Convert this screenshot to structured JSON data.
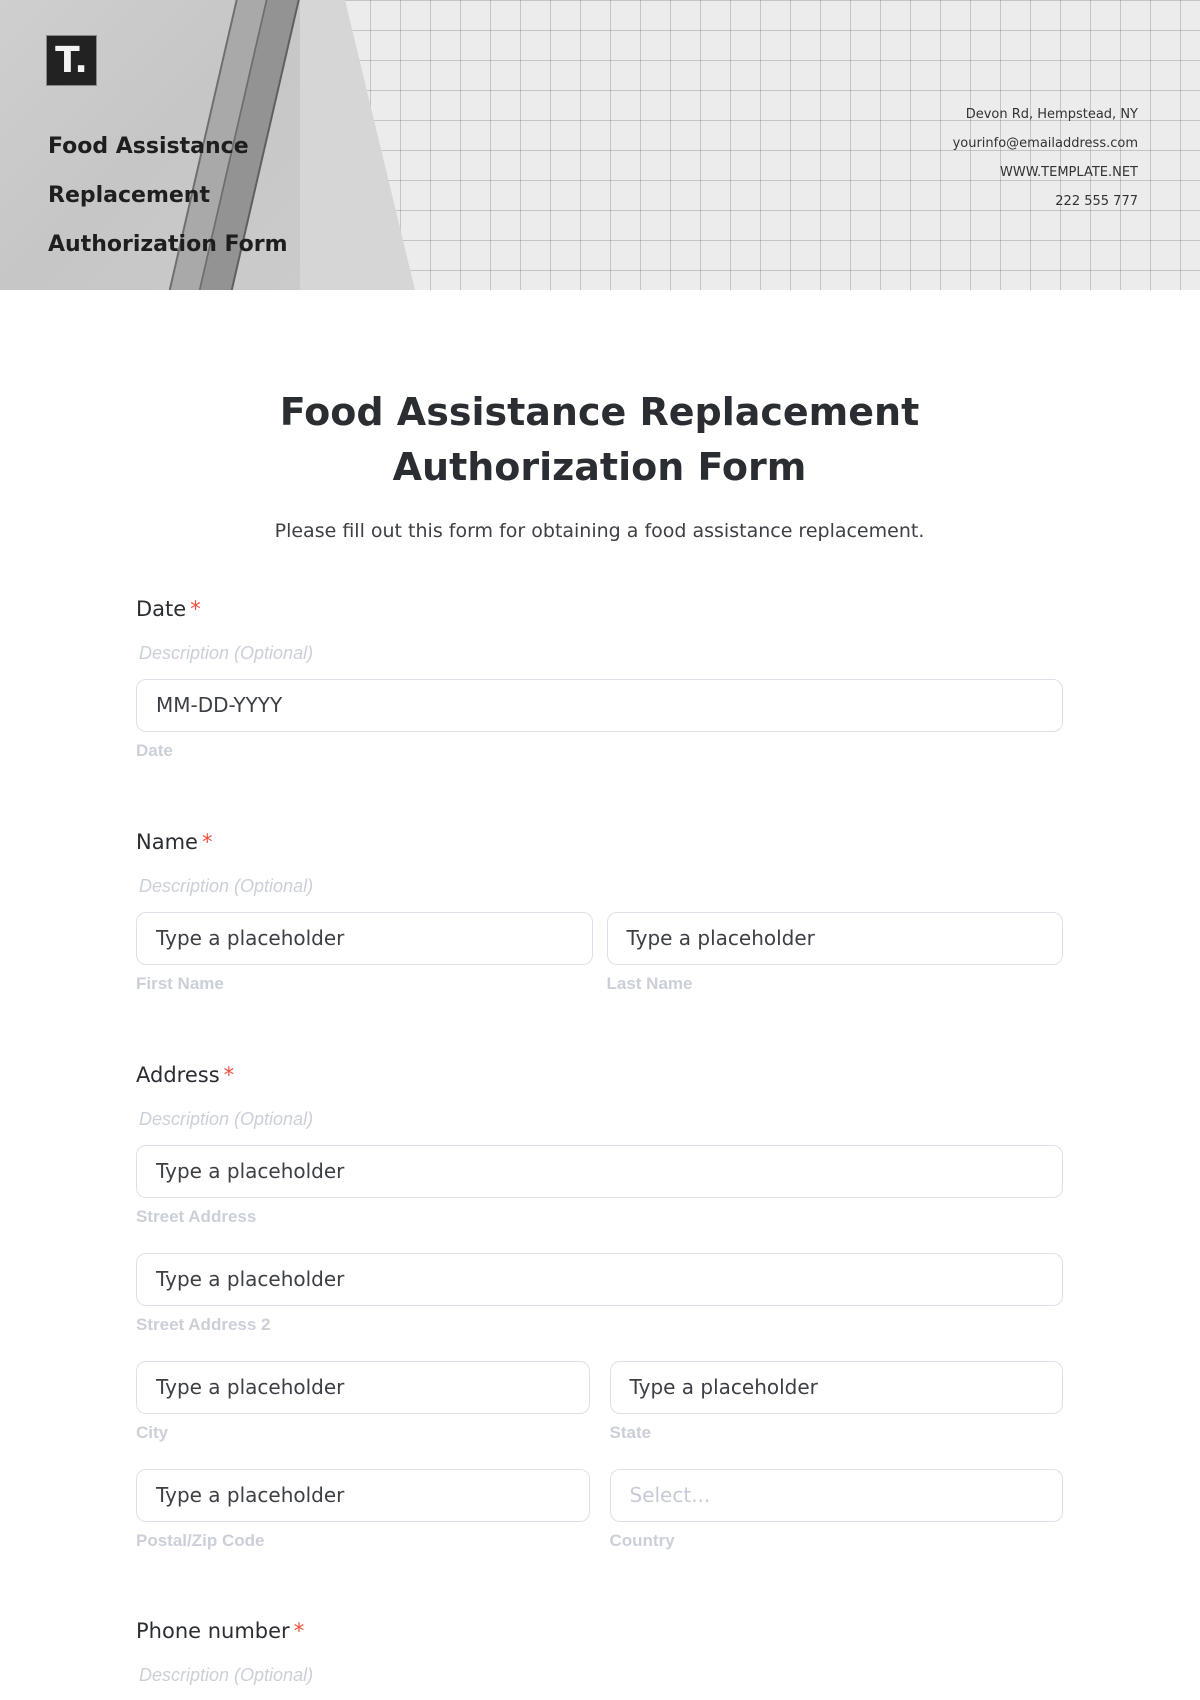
{
  "header": {
    "logo": "T.",
    "brand_title_lines": [
      "Food Assistance",
      "Replacement",
      "Authorization Form"
    ],
    "contact": {
      "address": "Devon Rd, Hempstead, NY",
      "email": "yourinfo@emailaddress.com",
      "website": "WWW.TEMPLATE.NET",
      "phone": "222 555 777"
    }
  },
  "form": {
    "title": "Food Assistance Replacement Authorization Form",
    "subtitle": "Please fill out this form for obtaining a food assistance replacement.",
    "required_marker": "*",
    "fields": {
      "date": {
        "label": "Date",
        "description": "Description (Optional)",
        "placeholder": "MM-DD-YYYY",
        "sublabel": "Date"
      },
      "name": {
        "label": "Name",
        "description": "Description (Optional)",
        "first": {
          "placeholder": "Type a placeholder",
          "sublabel": "First Name"
        },
        "last": {
          "placeholder": "Type a placeholder",
          "sublabel": "Last Name"
        }
      },
      "address": {
        "label": "Address",
        "description": "Description (Optional)",
        "street": {
          "placeholder": "Type a placeholder",
          "sublabel": "Street Address"
        },
        "street2": {
          "placeholder": "Type a placeholder",
          "sublabel": "Street Address 2"
        },
        "city": {
          "placeholder": "Type a placeholder",
          "sublabel": "City"
        },
        "state": {
          "placeholder": "Type a placeholder",
          "sublabel": "State"
        },
        "zip": {
          "placeholder": "Type a placeholder",
          "sublabel": "Postal/Zip Code"
        },
        "country": {
          "placeholder": "Select...",
          "sublabel": "Country"
        }
      },
      "phone": {
        "label": "Phone number",
        "description": "Description (Optional)"
      }
    }
  },
  "colors": {
    "required": "#ef4e3a",
    "input_border": "#dde1e7",
    "muted_text": "#cbd0d8",
    "heading": "#2a2d31"
  }
}
